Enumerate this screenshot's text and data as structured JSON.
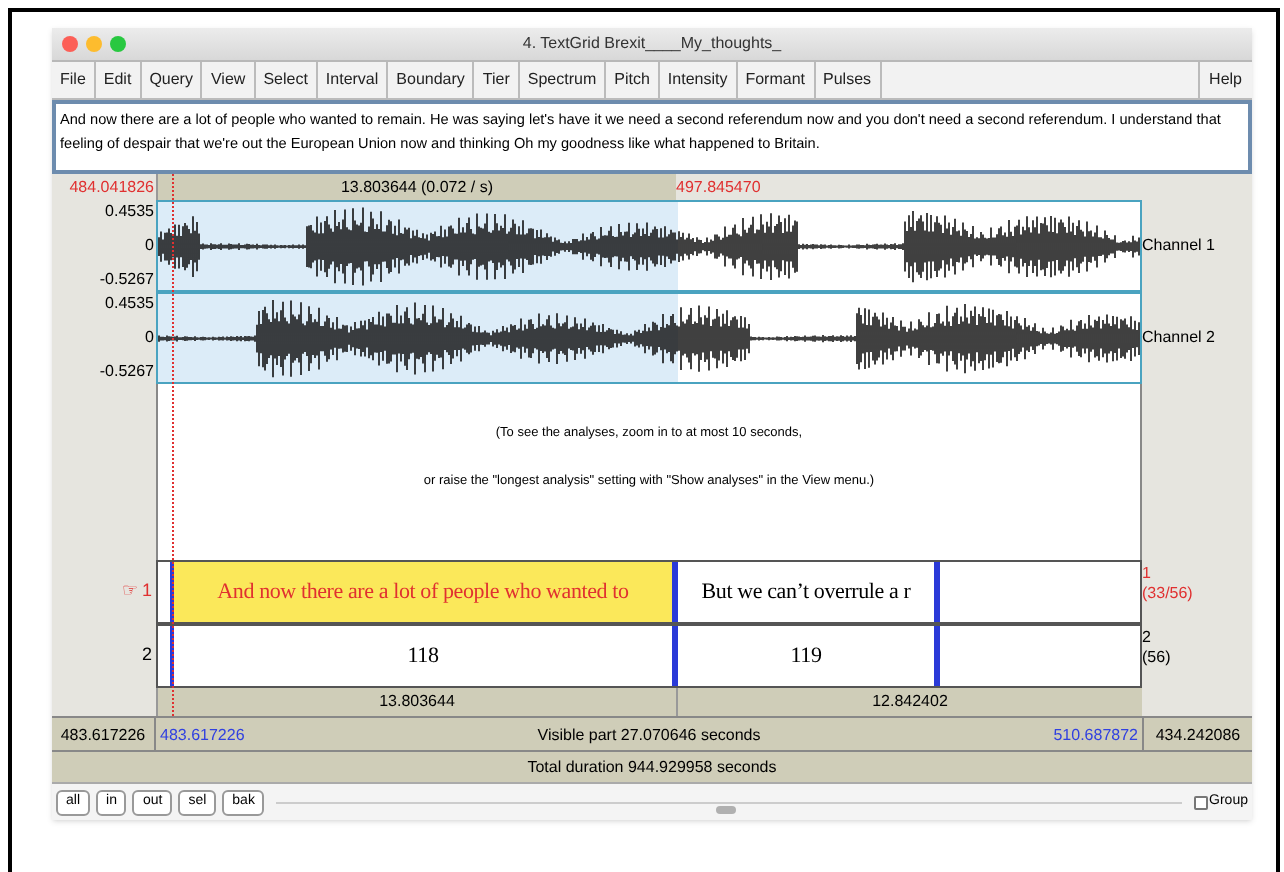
{
  "window": {
    "title": "4. TextGrid Brexit____My_thoughts_"
  },
  "menu": [
    {
      "label": "File"
    },
    {
      "label": "Edit"
    },
    {
      "label": "Query"
    },
    {
      "label": "View"
    },
    {
      "label": "Select"
    },
    {
      "label": "Interval"
    },
    {
      "label": "Boundary"
    },
    {
      "label": "Tier"
    },
    {
      "label": "Spectrum"
    },
    {
      "label": "Pitch"
    },
    {
      "label": "Intensity"
    },
    {
      "label": "Formant"
    },
    {
      "label": "Pulses"
    }
  ],
  "help_menu": "Help",
  "transcript": "And now there are a lot of people who wanted to remain. He was saying let's have it we need a second referendum now and you don't need a second referendum. I understand that feeling of despair that we're out the European Union now and thinking Oh my goodness like what happened to Britain.",
  "top_ruler": {
    "cursor_time": "484.041826",
    "selection_duration": "13.803644 (0.072 / s)",
    "end_time": "497.845470"
  },
  "channels": [
    {
      "label": "Channel 1",
      "max": "0.4535",
      "zero": "0",
      "min": "-0.5267"
    },
    {
      "label": "Channel 2",
      "max": "0.4535",
      "zero": "0",
      "min": "-0.5267"
    }
  ],
  "analysis_message": [
    "(To see the analyses, zoom in to at most 10 seconds,",
    "or raise the \"longest analysis\" setting with \"Show analyses\" in the View menu.)"
  ],
  "tiers": [
    {
      "pointer": "☞",
      "number": "1",
      "selected": true,
      "side_number": "1",
      "count": "(33/56)",
      "intervals": [
        {
          "text": "And now there are a lot of people who wanted to",
          "selected": true
        },
        {
          "text": "But we can’t overrule a r",
          "selected": false
        }
      ]
    },
    {
      "number": "2",
      "selected": false,
      "side_number": "2",
      "count": "(56)",
      "intervals": [
        {
          "text": "118",
          "selected": false
        },
        {
          "text": "119",
          "selected": false
        }
      ]
    }
  ],
  "bottom_ruler": [
    "13.803644",
    "12.842402"
  ],
  "visible_row": {
    "window_start": "483.617226",
    "view_start": "483.617226",
    "visible_part": "Visible part 27.070646 seconds",
    "view_end": "510.687872",
    "window_end": "434.242086"
  },
  "total_duration": "Total duration 944.929958 seconds",
  "buttons": [
    {
      "label": "all"
    },
    {
      "label": "in"
    },
    {
      "label": "out"
    },
    {
      "label": "sel"
    },
    {
      "label": "bak"
    }
  ],
  "group": {
    "label": "Group",
    "checked": false
  }
}
